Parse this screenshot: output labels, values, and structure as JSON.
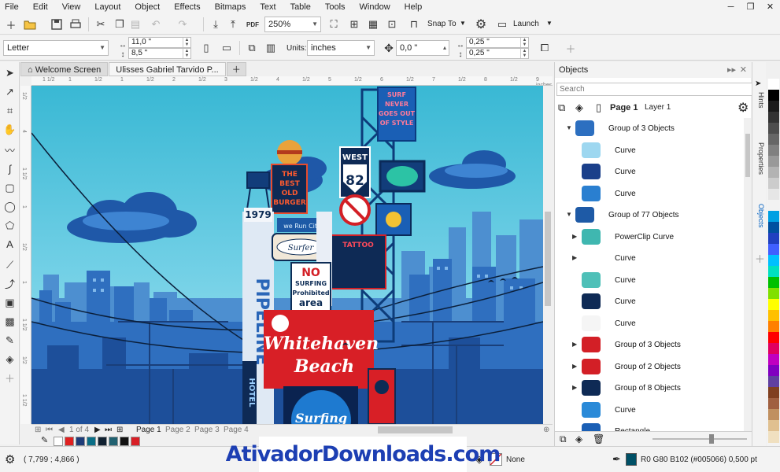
{
  "menu": [
    "File",
    "Edit",
    "View",
    "Layout",
    "Object",
    "Effects",
    "Bitmaps",
    "Text",
    "Table",
    "Tools",
    "Window",
    "Help"
  ],
  "window_controls": {
    "minimize": "─",
    "restore": "❐",
    "close": "✕"
  },
  "toolbar": {
    "zoom": "250%",
    "snap_to": "Snap To",
    "launch": "Launch",
    "pdf_label": "PDF"
  },
  "property_bar": {
    "page_size": "Letter",
    "width": "11,0 \"",
    "height": "8,5 \"",
    "units_label": "Units:",
    "units": "inches",
    "nudge": "0,0 \"",
    "dup_x": "0,25 \"",
    "dup_y": "0,25 \""
  },
  "tabs": {
    "welcome": "Welcome Screen",
    "document": "Ulisses Gabriel Tarvido P..."
  },
  "rulers": {
    "h": [
      "1 1/2",
      "1",
      "1/2",
      "1",
      "1/2",
      "2",
      "1/2",
      "3",
      "1/2",
      "4",
      "1/2",
      "5",
      "1/2",
      "6",
      "1/2",
      "7",
      "1/2",
      "8",
      "1/2",
      "9 inches"
    ],
    "v": [
      "1/2",
      "4",
      "1 1/2",
      "1",
      "1/2",
      "1",
      "1 1/2",
      "1/2",
      "1 1/2"
    ]
  },
  "doc_nav": {
    "counter": "1  of  4",
    "pages": [
      "Page 1",
      "Page 2",
      "Page 3",
      "Page 4"
    ]
  },
  "status": {
    "coords": "( 7,799 ; 4,866 )",
    "fill": "None",
    "outline": "R0 G80 B102 (#005066)  0,500 pt"
  },
  "docker": {
    "title": "Objects",
    "search_placeholder": "Search",
    "page": "Page 1",
    "layer": "Layer 1",
    "rows": [
      {
        "label": "Group of 3 Objects",
        "level": 0,
        "expander": "▼"
      },
      {
        "label": "Curve",
        "level": 1,
        "expander": ""
      },
      {
        "label": "Curve",
        "level": 1,
        "expander": ""
      },
      {
        "label": "Curve",
        "level": 1,
        "expander": ""
      },
      {
        "label": "Group of 77 Objects",
        "level": 0,
        "expander": "▼"
      },
      {
        "label": "PowerClip Curve",
        "level": 1,
        "expander": "▶"
      },
      {
        "label": "Curve",
        "level": 1,
        "expander": "▶"
      },
      {
        "label": "Curve",
        "level": 1,
        "expander": ""
      },
      {
        "label": "Curve",
        "level": 1,
        "expander": ""
      },
      {
        "label": "Curve",
        "level": 1,
        "expander": ""
      },
      {
        "label": "Group of 3 Objects",
        "level": 1,
        "expander": "▶"
      },
      {
        "label": "Group of 2 Objects",
        "level": 1,
        "expander": "▶"
      },
      {
        "label": "Group of 8 Objects",
        "level": 1,
        "expander": "▶"
      },
      {
        "label": "Curve",
        "level": 1,
        "expander": ""
      },
      {
        "label": "Rectangle",
        "level": 1,
        "expander": ""
      }
    ]
  },
  "side_tabs": [
    "Hints",
    "Properties",
    "Objects"
  ],
  "palette_colors": [
    "#ffffff",
    "#000000",
    "#1a1a1a",
    "#333333",
    "#4d4d4d",
    "#666666",
    "#808080",
    "#999999",
    "#b3b3b3",
    "#cccccc",
    "#e6e6e6",
    "#f2f2f2",
    "#00a0e3",
    "#0050a0",
    "#2040c0",
    "#4060ff",
    "#00c0ff",
    "#00e0c0",
    "#00c000",
    "#80e000",
    "#ffff00",
    "#ffc000",
    "#ff8000",
    "#ff0000",
    "#e00060",
    "#c000c0",
    "#8000c0",
    "#6040a0",
    "#804020",
    "#a06040",
    "#c09060",
    "#e0c090",
    "#f0e0c0"
  ],
  "doc_palette": [
    "#ffffff",
    "#e02020",
    "#1e3c78",
    "#0a6e86",
    "#102030",
    "#206070",
    "#111111",
    "#d81f26"
  ],
  "artwork": {
    "burger_sign": [
      "THE",
      "BEST",
      "OLD",
      "BURGER"
    ],
    "surf_sign": [
      "SURF",
      "NEVER",
      "GOES OUT",
      "OF STYLE"
    ],
    "west": "WEST",
    "route": "82",
    "year": "1979",
    "we_run": "we Run City",
    "surfer": "Surfer",
    "no": "NO",
    "surfing": "SURFING",
    "prohibited": "Prohibited",
    "area": "area",
    "whitehaven": "Whitehaven",
    "beach": "Beach",
    "surfing_small": "Surfing",
    "hotel": "HOTEL",
    "pipeline": "PIPELINE",
    "tattoo": "TATTOO"
  },
  "watermark": "AtivadorDownloads.com"
}
